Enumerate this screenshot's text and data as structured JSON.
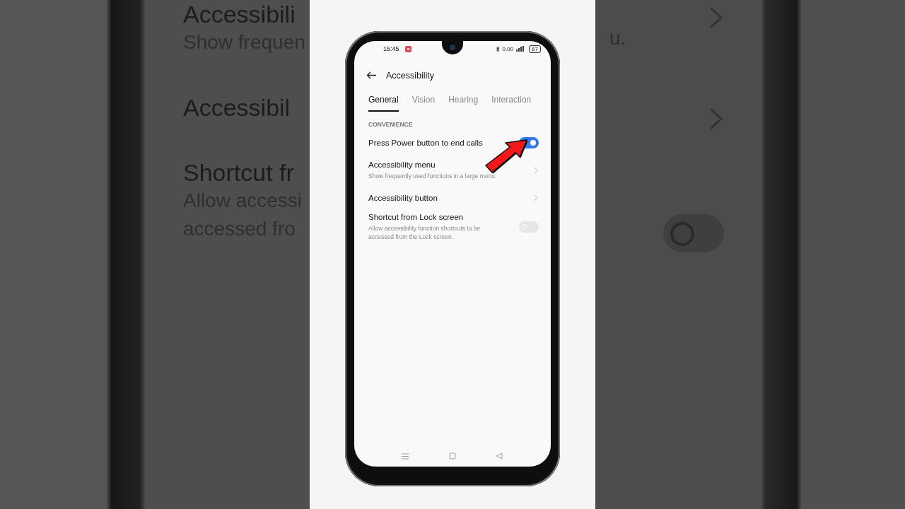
{
  "background": {
    "left_texts": [
      {
        "kind": "title",
        "text": "Accessibili"
      },
      {
        "kind": "sub",
        "text": "Show frequen"
      },
      {
        "kind": "title",
        "text": "Accessibil"
      },
      {
        "kind": "title",
        "text": "Shortcut fr"
      },
      {
        "kind": "sub",
        "text": "Allow accessi"
      },
      {
        "kind": "sub",
        "text": "accessed fro"
      }
    ],
    "right_text": "u.",
    "toggle_on": false
  },
  "status_bar": {
    "time": "15:45",
    "net_speed": "0.00",
    "battery": "67"
  },
  "header": {
    "title": "Accessibility"
  },
  "tabs": [
    {
      "label": "General",
      "selected": true
    },
    {
      "label": "Vision",
      "selected": false
    },
    {
      "label": "Hearing",
      "selected": false
    },
    {
      "label": "Interaction",
      "selected": false
    }
  ],
  "section": "CONVENIENCE",
  "settings": [
    {
      "kind": "toggle",
      "title": "Press Power button to end calls",
      "on": true
    },
    {
      "kind": "link",
      "title": "Accessibility menu",
      "subtitle": "Show frequently used functions in a large menu."
    },
    {
      "kind": "link",
      "title": "Accessibility button"
    },
    {
      "kind": "toggle",
      "title": "Shortcut from Lock screen",
      "subtitle": "Allow accessibility function shortcuts to be accessed from the Lock screen.",
      "on": false
    }
  ]
}
